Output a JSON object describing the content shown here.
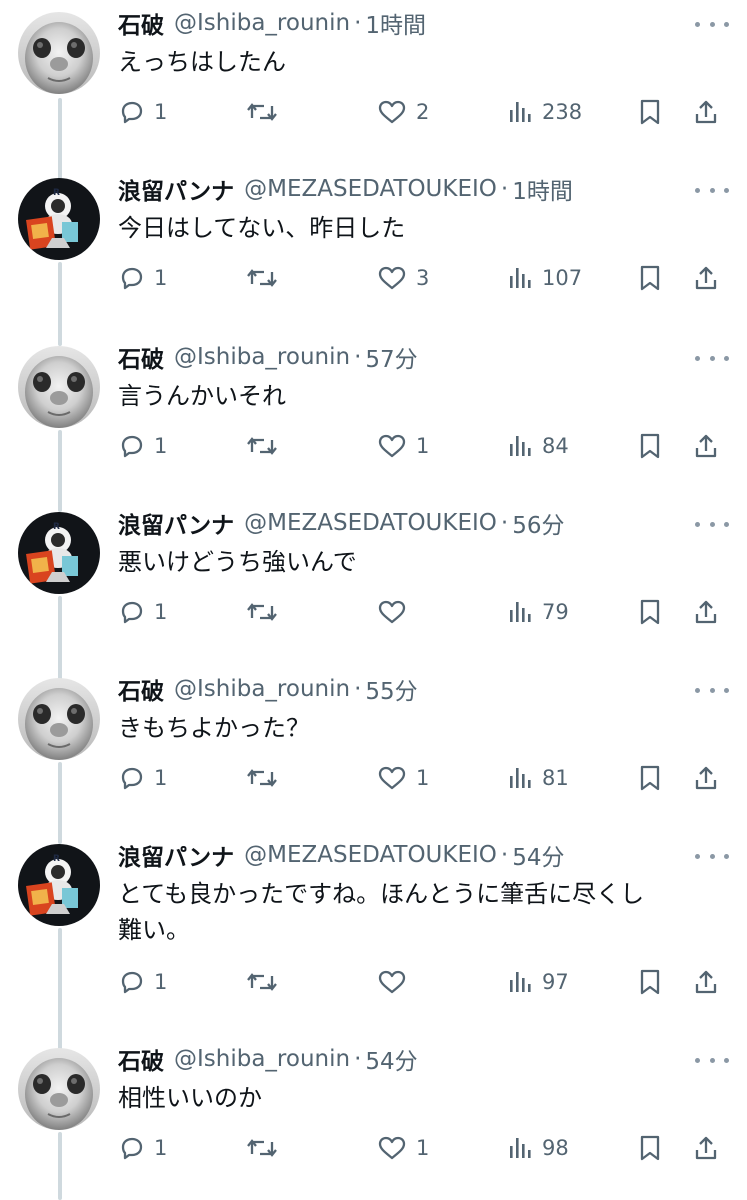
{
  "tweets": [
    {
      "name": "石破",
      "handle": "@Ishiba_rounin",
      "dot": "·",
      "time": "1時間",
      "text": "えっちはしたん",
      "reply_count": "1",
      "retweet_count": "",
      "like_count": "2",
      "view_count": "238",
      "avatar": "ishiba-avatar"
    },
    {
      "name": "浪留パンナ",
      "handle": "@MEZASEDATOUKEIO",
      "dot": "·",
      "time": "1時間",
      "text": "今日はしてない、昨日した",
      "reply_count": "1",
      "retweet_count": "",
      "like_count": "3",
      "view_count": "107",
      "avatar": "ronin-panna-avatar"
    },
    {
      "name": "石破",
      "handle": "@Ishiba_rounin",
      "dot": "·",
      "time": "57分",
      "text": "言うんかいそれ",
      "reply_count": "1",
      "retweet_count": "",
      "like_count": "1",
      "view_count": "84",
      "avatar": "ishiba-avatar"
    },
    {
      "name": "浪留パンナ",
      "handle": "@MEZASEDATOUKEIO",
      "dot": "·",
      "time": "56分",
      "text": "悪いけどうち強いんで",
      "reply_count": "1",
      "retweet_count": "",
      "like_count": "",
      "view_count": "79",
      "avatar": "ronin-panna-avatar"
    },
    {
      "name": "石破",
      "handle": "@Ishiba_rounin",
      "dot": "·",
      "time": "55分",
      "text": "きもちよかった？",
      "reply_count": "1",
      "retweet_count": "",
      "like_count": "1",
      "view_count": "81",
      "avatar": "ishiba-avatar"
    },
    {
      "name": "浪留パンナ",
      "handle": "@MEZASEDATOUKEIO",
      "dot": "·",
      "time": "54分",
      "text": "とても良かったですね。ほんとうに筆舌に尽くし\n難い。",
      "reply_count": "1",
      "retweet_count": "",
      "like_count": "",
      "view_count": "97",
      "avatar": "ronin-panna-avatar"
    },
    {
      "name": "石破",
      "handle": "@Ishiba_rounin",
      "dot": "·",
      "time": "54分",
      "text": "相性いいのか",
      "reply_count": "1",
      "retweet_count": "",
      "like_count": "1",
      "view_count": "98",
      "avatar": "ishiba-avatar"
    }
  ],
  "colors": {
    "text": "#0f1419",
    "secondary": "#536471",
    "thread_line": "#cfd9de",
    "icon": "#536471"
  },
  "icons": {
    "reply": "reply-icon",
    "retweet": "retweet-icon",
    "like": "like-icon",
    "views": "views-icon",
    "bookmark": "bookmark-icon",
    "share": "share-icon",
    "more": "more-icon"
  }
}
